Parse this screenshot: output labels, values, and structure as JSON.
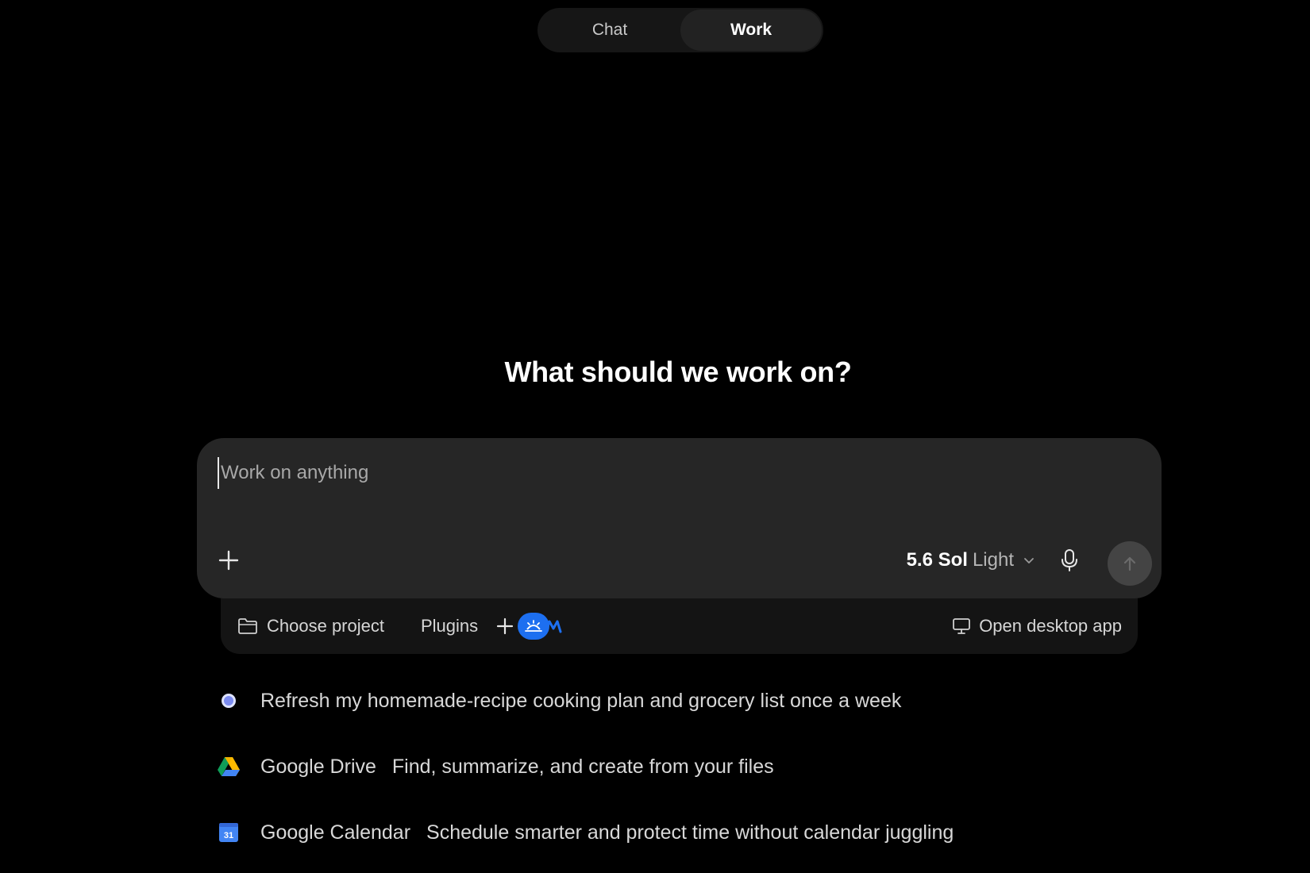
{
  "mode_toggle": {
    "tabs": [
      {
        "label": "Chat",
        "active": false
      },
      {
        "label": "Work",
        "active": true
      }
    ]
  },
  "headline": "What should we work on?",
  "composer": {
    "placeholder": "Work on anything",
    "model": {
      "name": "5.6 Sol",
      "variant": "Light"
    },
    "icons": {
      "add": "plus-icon",
      "mic": "microphone-icon",
      "send": "arrow-up-icon",
      "dropdown": "chevron-down-icon"
    }
  },
  "tray": {
    "choose_project": "Choose project",
    "plugins": "Plugins",
    "open_desktop": "Open desktop app",
    "icons": {
      "project": "folder-icon",
      "plugins_add": "plus-icon",
      "desktop": "monitor-icon"
    }
  },
  "suggestions": [
    {
      "title": "",
      "description": "Refresh my homemade-recipe cooking plan and grocery list once a week",
      "icon": "dot-icon"
    },
    {
      "title": "Google Drive",
      "description": "Find, summarize, and create from your files",
      "icon": "google-drive-icon"
    },
    {
      "title": "Google Calendar",
      "description": "Schedule smarter and protect time without calendar juggling",
      "icon": "google-calendar-icon",
      "icon_text": "31"
    }
  ],
  "colors": {
    "background": "#000000",
    "composer": "#262626",
    "tray": "#141414",
    "accent_blue": "#1d6ff0"
  }
}
